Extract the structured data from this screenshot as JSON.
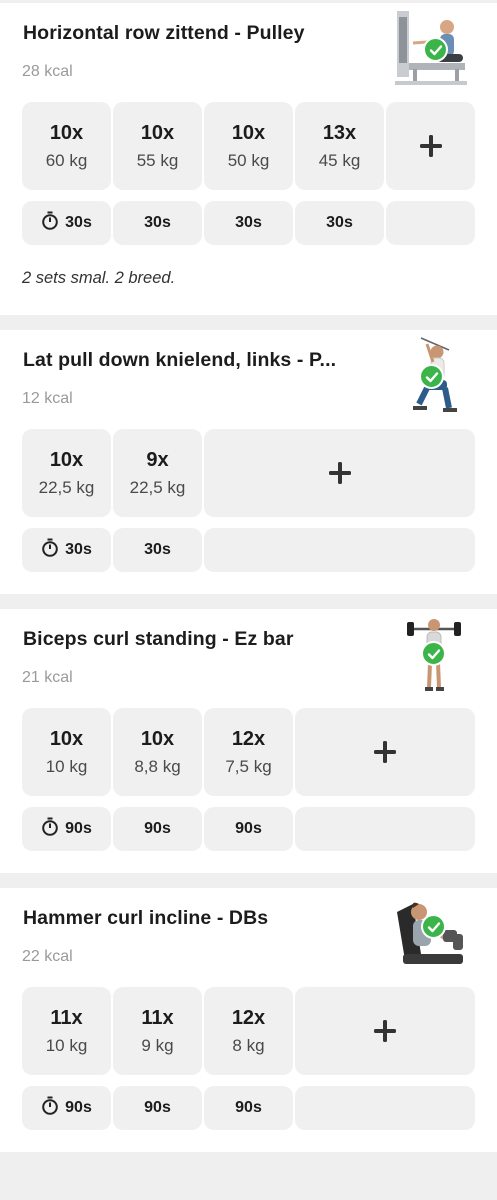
{
  "colors": {
    "check": "#3bb54a",
    "cell_bg": "#f0f0f0",
    "kcal": "#9a9a9a"
  },
  "exercises": [
    {
      "title": "Horizontal row zittend - Pulley",
      "kcal": "28 kcal",
      "image": "cable-row-machine",
      "sets": [
        {
          "reps": "10x",
          "weight": "60 kg"
        },
        {
          "reps": "10x",
          "weight": "55 kg"
        },
        {
          "reps": "10x",
          "weight": "50 kg"
        },
        {
          "reps": "13x",
          "weight": "45 kg"
        }
      ],
      "rests": [
        "30s",
        "30s",
        "30s",
        "30s"
      ],
      "note": "2 sets smal. 2 breed."
    },
    {
      "title": "Lat pull down knielend, links - P...",
      "kcal": "12 kcal",
      "image": "kneeling-pulldown",
      "sets": [
        {
          "reps": "10x",
          "weight": "22,5 kg"
        },
        {
          "reps": "9x",
          "weight": "22,5 kg"
        }
      ],
      "rests": [
        "30s",
        "30s"
      ]
    },
    {
      "title": "Biceps curl standing - Ez bar",
      "kcal": "21 kcal",
      "image": "ez-bar-curl",
      "sets": [
        {
          "reps": "10x",
          "weight": "10 kg"
        },
        {
          "reps": "10x",
          "weight": "8,8 kg"
        },
        {
          "reps": "12x",
          "weight": "7,5 kg"
        }
      ],
      "rests": [
        "90s",
        "90s",
        "90s"
      ]
    },
    {
      "title": "Hammer curl incline - DBs",
      "kcal": "22 kcal",
      "image": "incline-hammer-curl",
      "sets": [
        {
          "reps": "11x",
          "weight": "10 kg"
        },
        {
          "reps": "11x",
          "weight": "9 kg"
        },
        {
          "reps": "12x",
          "weight": "8 kg"
        }
      ],
      "rests": [
        "90s",
        "90s",
        "90s"
      ]
    }
  ]
}
